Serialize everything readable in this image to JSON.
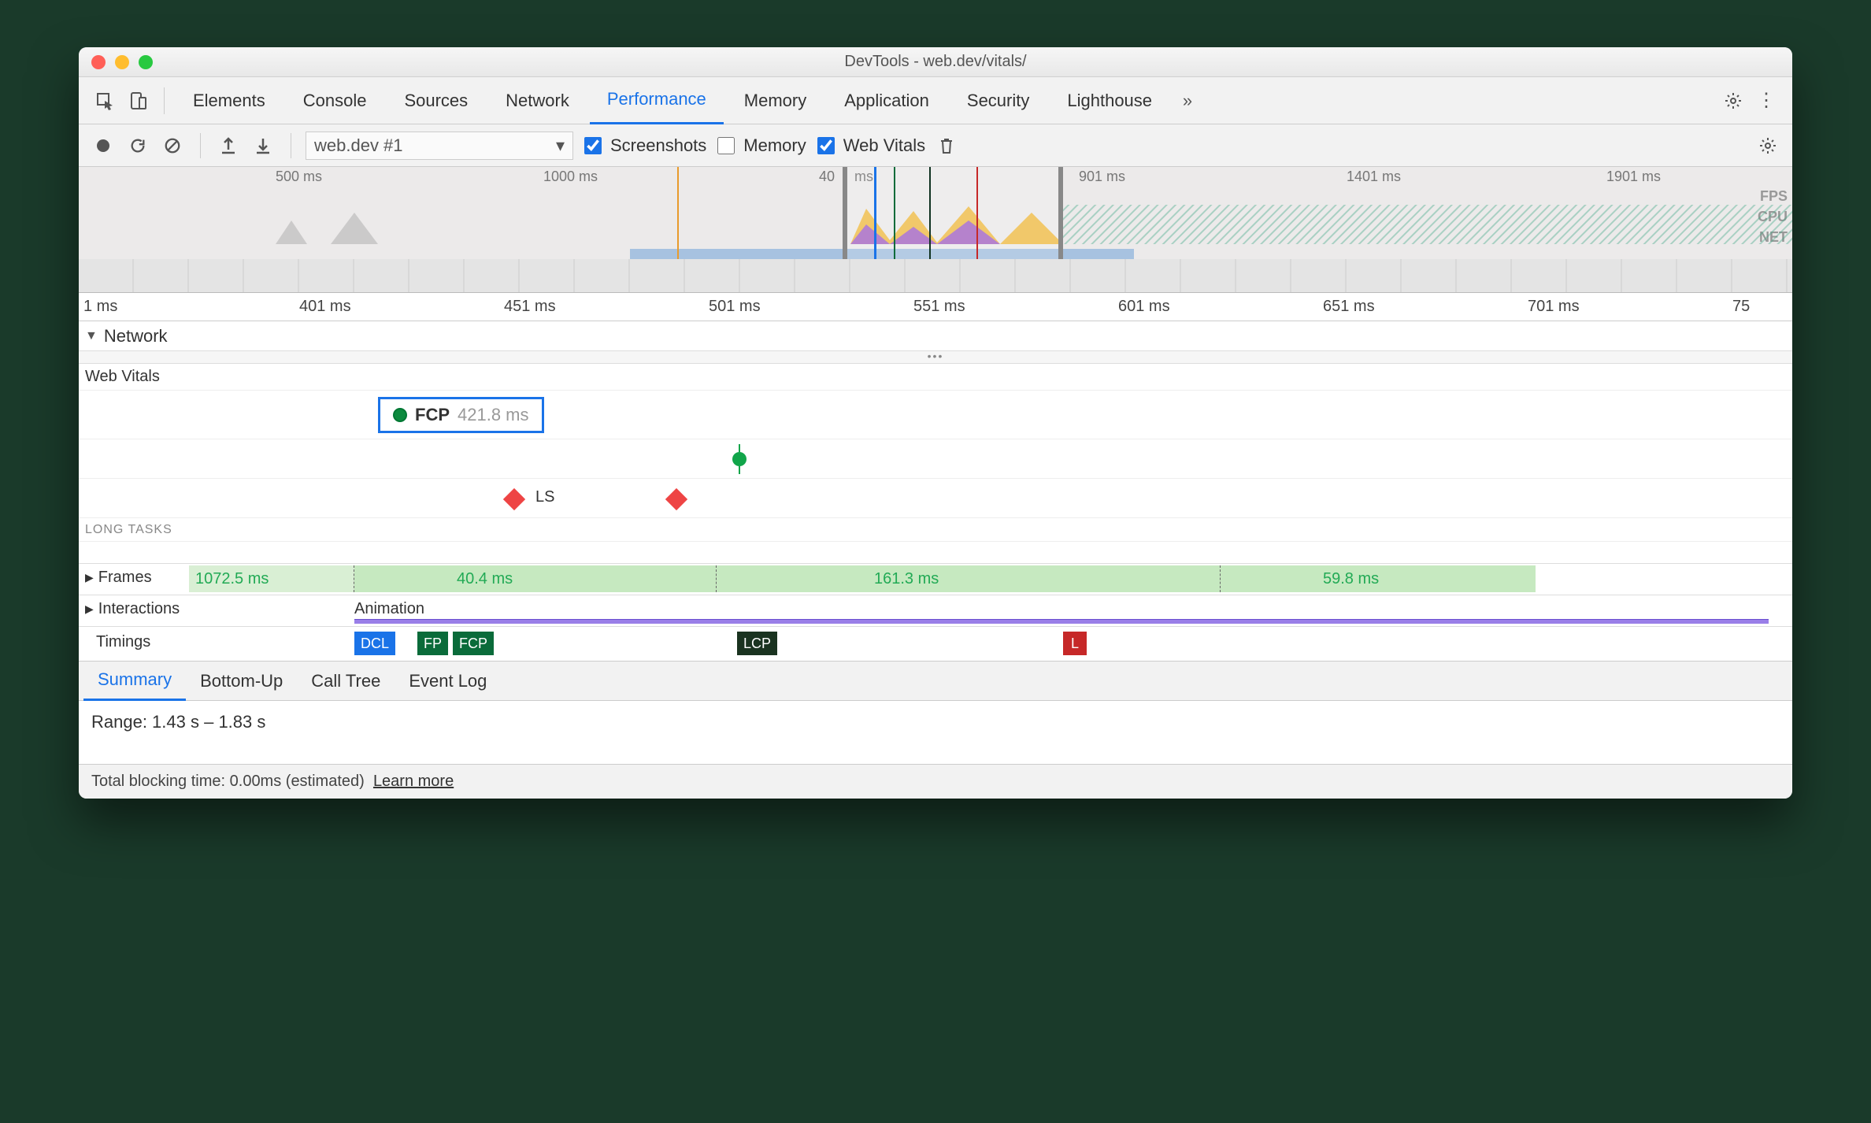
{
  "window_title": "DevTools - web.dev/vitals/",
  "tabs": [
    "Elements",
    "Console",
    "Sources",
    "Network",
    "Performance",
    "Memory",
    "Application",
    "Security",
    "Lighthouse"
  ],
  "active_tab": "Performance",
  "toolbar": {
    "dropdown": "web.dev #1",
    "screenshots_label": "Screenshots",
    "memory_label": "Memory",
    "webvitals_label": "Web Vitals",
    "screenshots_checked": true,
    "memory_checked": false,
    "webvitals_checked": true
  },
  "overview": {
    "ticks": [
      "500 ms",
      "1000 ms",
      "40",
      "ms",
      "901 ms",
      "1401 ms",
      "1901 ms"
    ],
    "lane_labels": [
      "FPS",
      "CPU",
      "NET"
    ]
  },
  "ruler": [
    "1 ms",
    "401 ms",
    "451 ms",
    "501 ms",
    "551 ms",
    "601 ms",
    "651 ms",
    "701 ms",
    "75"
  ],
  "network_row": "Network",
  "webvitals": {
    "section": "Web Vitals",
    "fcp_label": "FCP",
    "fcp_value": "421.8 ms",
    "ls_label": "LS",
    "longtasks_label": "LONG TASKS"
  },
  "frames": {
    "label": "Frames",
    "blocks": [
      "1072.5 ms",
      "40.4 ms",
      "161.3 ms",
      "59.8 ms"
    ]
  },
  "interactions": {
    "label": "Interactions",
    "animation": "Animation"
  },
  "timings": {
    "label": "Timings",
    "badges": [
      {
        "text": "DCL",
        "color": "#1a73e8"
      },
      {
        "text": "FP",
        "color": "#0a6b3a"
      },
      {
        "text": "FCP",
        "color": "#0a6b3a"
      },
      {
        "text": "LCP",
        "color": "#113322"
      },
      {
        "text": "L",
        "color": "#c62828"
      }
    ]
  },
  "bottom_tabs": [
    "Summary",
    "Bottom-Up",
    "Call Tree",
    "Event Log"
  ],
  "active_bottom_tab": "Summary",
  "summary_range": "Range: 1.43 s – 1.83 s",
  "footer": {
    "text": "Total blocking time: 0.00ms (estimated)",
    "link": "Learn more"
  }
}
